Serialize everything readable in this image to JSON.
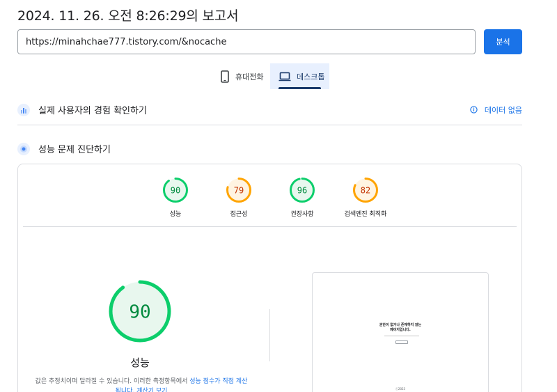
{
  "report": {
    "title": "2024. 11. 26. 오전 8:26:29의 보고서"
  },
  "search": {
    "url": "https://minahchae777.tistory.com/&nocache",
    "analyze_label": "분석"
  },
  "tabs": [
    {
      "label": "휴대전화",
      "icon": "smartphone-icon",
      "selected": false
    },
    {
      "label": "데스크톱",
      "icon": "laptop-icon",
      "selected": true
    }
  ],
  "field_data": {
    "title": "실제 사용자의 경험 확인하기",
    "status": "데이터 없음",
    "icon": "users-chart-icon"
  },
  "lab_data": {
    "title": "성능 문제 진단하기",
    "icon": "lighthouse-icon"
  },
  "scores": [
    {
      "value": "90",
      "fraction": 0.9,
      "label": "성능",
      "color": "#0cce6b",
      "text_color": "#008a3e",
      "bg": "#e8f7ee"
    },
    {
      "value": "79",
      "fraction": 0.79,
      "label": "접근성",
      "color": "#ffa400",
      "text_color": "#c33300",
      "bg": "#fff4e2"
    },
    {
      "value": "96",
      "fraction": 0.96,
      "label": "권장사항",
      "color": "#0cce6b",
      "text_color": "#008a3e",
      "bg": "#e8f7ee"
    },
    {
      "value": "82",
      "fraction": 0.82,
      "label": "검색엔진 최적화",
      "color": "#ffa400",
      "text_color": "#c33300",
      "bg": "#fff4e2"
    }
  ],
  "performance": {
    "value": "90",
    "fraction": 0.9,
    "label": "성능",
    "note_prefix": "값은 추정치이며 달라질 수 있습니다. 이러한 측정항목에서 ",
    "note_link": "성능 점수가 직접 계산됩니다. 계산기 보기"
  },
  "screenshot": {
    "line1": "권한이 없거나 존재하지 않는",
    "line2": "페이지입니다.",
    "footer": "ⓒ2023"
  }
}
